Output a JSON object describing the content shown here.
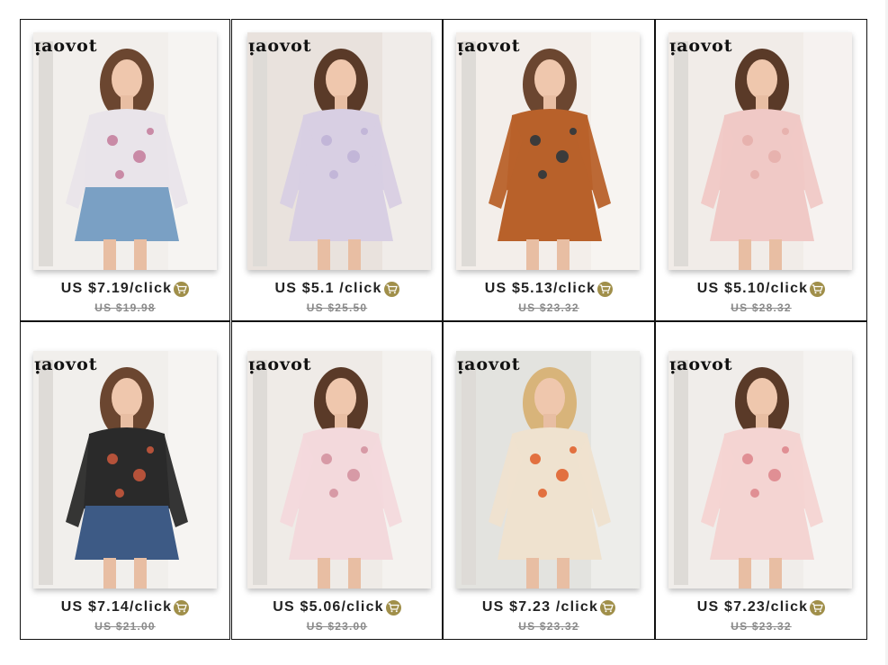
{
  "brand_watermark": "ᴉaovot",
  "cart_icon": "shopping-cart-icon",
  "products": [
    {
      "price": "US $7.19/click",
      "original_price": "US $19.98",
      "bg": "#f2efec",
      "dress": "#e9e4ea",
      "accent": "#c98aa6",
      "hair": "#6b4630",
      "bottom": "#7aa0c4"
    },
    {
      "price": "US $5.1 /click",
      "original_price": "US $25.50",
      "bg": "#e9e2dd",
      "dress": "#d8cfe3",
      "accent": "#c2b6d8",
      "hair": "#5a3a28",
      "bottom": "#d8cfe3"
    },
    {
      "price": "US $5.13/click",
      "original_price": "US $23.32",
      "bg": "#f3eeea",
      "dress": "#b8612a",
      "accent": "#3b3b3b",
      "hair": "#6b4630",
      "bottom": "#b8612a"
    },
    {
      "price": "US $5.10/click",
      "original_price": "US $28.32",
      "bg": "#f1ece8",
      "dress": "#f0c9c6",
      "accent": "#e7b2ae",
      "hair": "#5a3a28",
      "bottom": "#f0c9c6"
    },
    {
      "price": "US $7.14/click",
      "original_price": "US $21.00",
      "bg": "#f1efec",
      "dress": "#2a2a2a",
      "accent": "#b5523a",
      "hair": "#6b4630",
      "bottom": "#3d5a85"
    },
    {
      "price": "US $5.06/click",
      "original_price": "US $23.00",
      "bg": "#efebe7",
      "dress": "#f3d9dc",
      "accent": "#d79aa6",
      "hair": "#5a3a28",
      "bottom": "#f3d9dc"
    },
    {
      "price": "US $7.23 /click",
      "original_price": "US $23.32",
      "bg": "#e3e3df",
      "dress": "#efe2cf",
      "accent": "#e2703f",
      "hair": "#d8b47a",
      "bottom": "#efe2cf"
    },
    {
      "price": "US $7.23/click",
      "original_price": "US $23.32",
      "bg": "#f0edea",
      "dress": "#f4d4d2",
      "accent": "#e08f94",
      "hair": "#5a3a28",
      "bottom": "#f4d4d2"
    }
  ]
}
